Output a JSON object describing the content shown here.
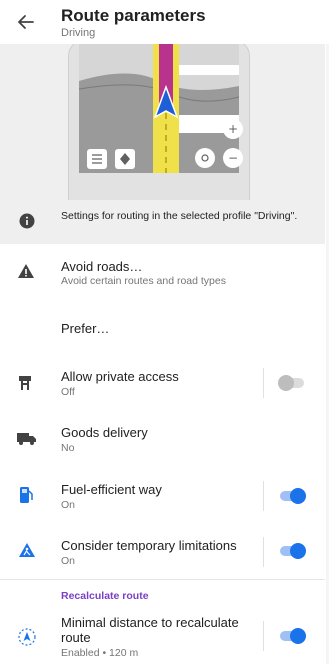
{
  "appbar": {
    "title": "Route parameters",
    "subtitle": "Driving"
  },
  "info": {
    "text": "Settings for routing in the selected profile \"Driving\"."
  },
  "rows": {
    "avoid_roads": {
      "title": "Avoid roads…",
      "sub": "Avoid certain routes and road types"
    },
    "prefer": {
      "title": "Prefer…"
    },
    "private_access": {
      "title": "Allow private access",
      "sub": "Off",
      "enabled": false
    },
    "goods_delivery": {
      "title": "Goods delivery",
      "sub": "No"
    },
    "fuel_efficient": {
      "title": "Fuel-efficient way",
      "sub": "On",
      "enabled": true
    },
    "temp_limitations": {
      "title": "Consider temporary limitations",
      "sub": "On",
      "enabled": true
    }
  },
  "recalculate": {
    "header": "Recalculate route",
    "min_distance": {
      "title": "Minimal distance to recalculate route",
      "sub": "Enabled • 120 m",
      "enabled": true
    }
  },
  "colors": {
    "accent": "#1a73e8",
    "section_header": "#7b3fc4",
    "route_purple": "#b8338c",
    "route_yellow": "#f0e04a"
  }
}
